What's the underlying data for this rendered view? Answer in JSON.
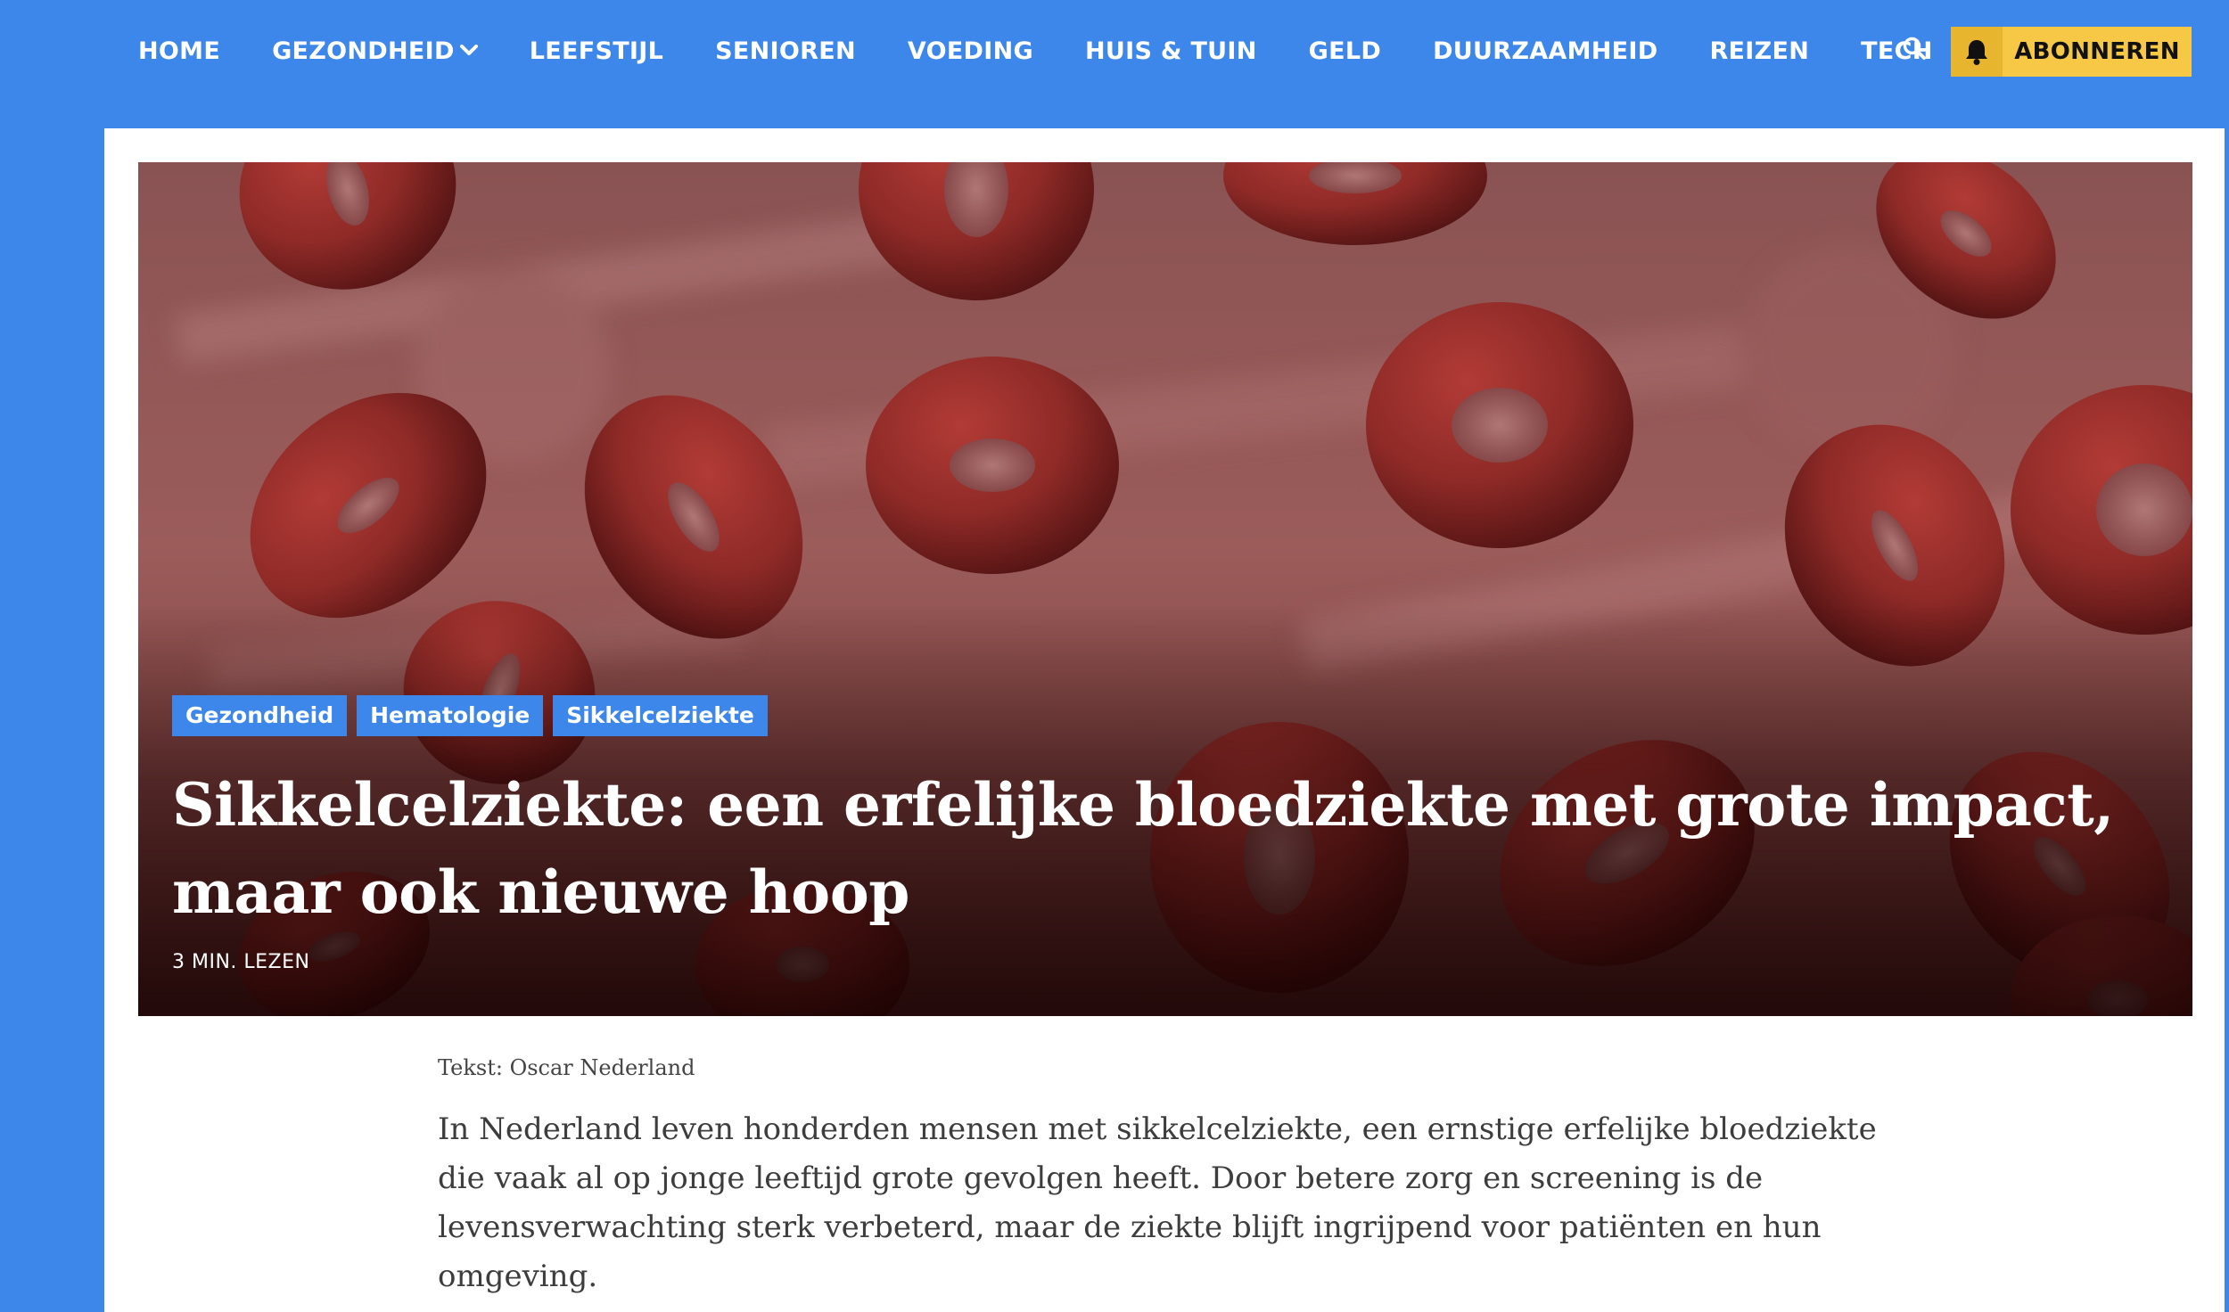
{
  "nav": {
    "items": [
      {
        "label": "HOME",
        "has_dropdown": false
      },
      {
        "label": "GEZONDHEID",
        "has_dropdown": true
      },
      {
        "label": "LEEFSTIJL",
        "has_dropdown": false
      },
      {
        "label": "SENIOREN",
        "has_dropdown": false
      },
      {
        "label": "VOEDING",
        "has_dropdown": false
      },
      {
        "label": "HUIS & TUIN",
        "has_dropdown": false
      },
      {
        "label": "GELD",
        "has_dropdown": false
      },
      {
        "label": "DUURZAAMHEID",
        "has_dropdown": false
      },
      {
        "label": "REIZEN",
        "has_dropdown": false
      },
      {
        "label": "TECH",
        "has_dropdown": false
      }
    ],
    "search_icon": "search-icon",
    "subscribe": {
      "label": "ABONNEREN",
      "icon": "bell-icon"
    }
  },
  "hero": {
    "image": "red-blood-cells",
    "tags": [
      "Gezondheid",
      "Hematologie",
      "Sikkelcelziekte"
    ],
    "title": "Sikkelcelziekte: een erfelijke bloedziekte met grote impact, maar ook nieuwe hoop",
    "read_time": "3 MIN. LEZEN"
  },
  "article": {
    "byline": "Tekst: Oscar Nederland",
    "intro": "In Nederland leven honderden mensen met sikkelcelziekte, een ernstige erfelijke bloedziekte die vaak al op jonge leeftijd grote gevolgen heeft. Door betere zorg en screening is de levensverwachting sterk verbeterd, maar de ziekte blijft ingrijpend voor patiënten en hun omgeving."
  },
  "colors": {
    "brand_blue": "#3d86ea",
    "subscribe_yellow": "#f6c845",
    "cell_red": "#8e2a27"
  }
}
